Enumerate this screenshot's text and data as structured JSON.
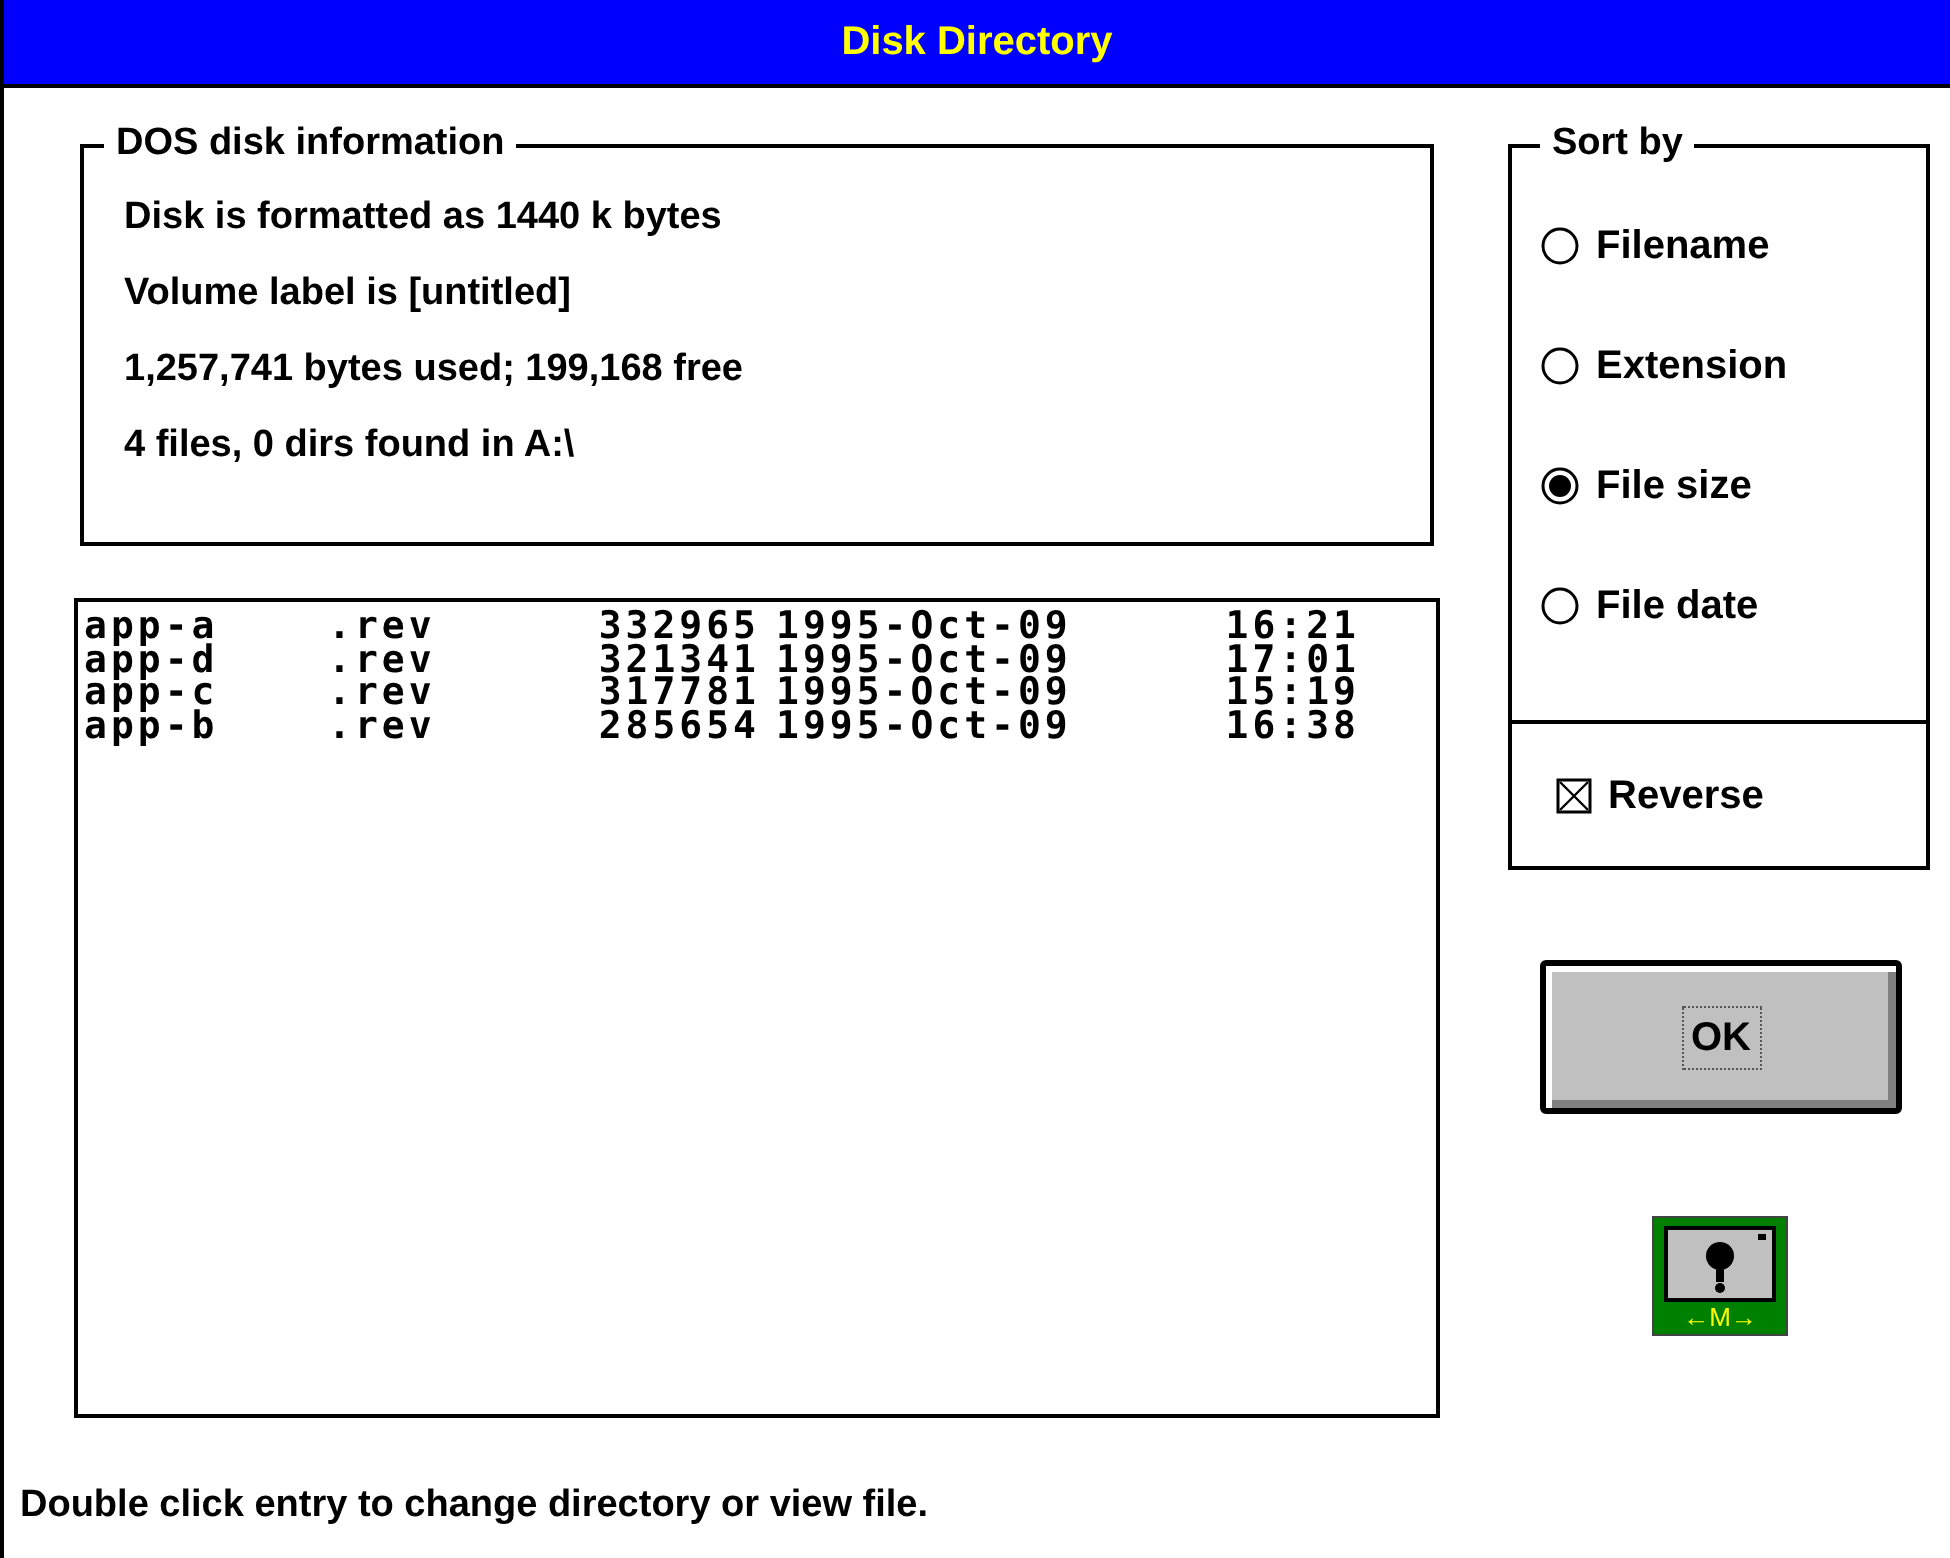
{
  "window": {
    "title": "Disk Directory"
  },
  "disk_info": {
    "title": "DOS disk information",
    "lines": [
      "Disk is formatted as 1440 k bytes",
      "Volume label is [untitled]",
      "1,257,741 bytes used; 199,168 free",
      "4 files, 0 dirs found in A:\\"
    ]
  },
  "file_list": [
    {
      "name": "app-a",
      "ext": ".rev",
      "size": "332965",
      "date": "1995-Oct-09",
      "time": "16:21",
      "selected": false
    },
    {
      "name": "app-d",
      "ext": ".rev",
      "size": "321341",
      "date": "1995-Oct-09",
      "time": "17:01",
      "selected": false
    },
    {
      "name": "app-c",
      "ext": ".rev",
      "size": "317781",
      "date": "1995-Oct-09",
      "time": "15:19",
      "selected": false
    },
    {
      "name": "app-b",
      "ext": ".rev",
      "size": "285654",
      "date": "1995-Oct-09",
      "time": "16:38",
      "selected": false
    }
  ],
  "sort_by": {
    "title": "Sort by",
    "options": [
      {
        "label": "Filename",
        "selected": false
      },
      {
        "label": "Extension",
        "selected": false
      },
      {
        "label": "File size",
        "selected": true
      },
      {
        "label": "File date",
        "selected": false
      }
    ],
    "reverse": {
      "label": "Reverse",
      "checked": true
    }
  },
  "ok_button": {
    "label": "OK"
  },
  "app_icon": {
    "label": "←M→"
  },
  "status_bar": "Double click entry to change directory or view file."
}
